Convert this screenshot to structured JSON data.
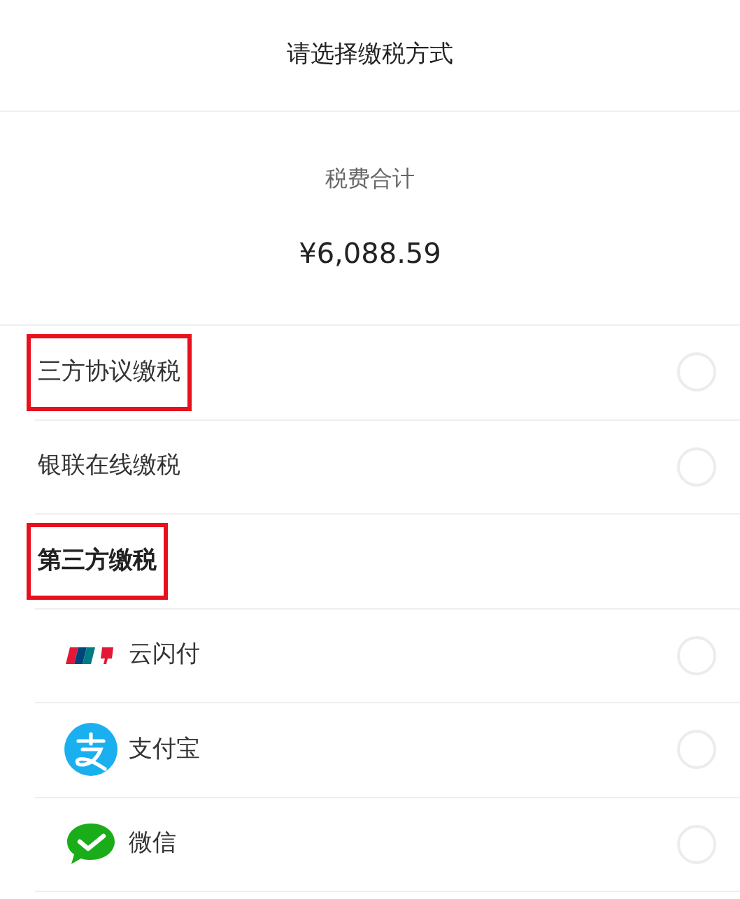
{
  "header": {
    "title": "请选择缴税方式"
  },
  "summary": {
    "label": "税费合计",
    "amount": "¥6,088.59"
  },
  "options": [
    {
      "kind": "option",
      "label": "三方协议缴税",
      "selected": false,
      "highlighted": true
    },
    {
      "kind": "option",
      "label": "银联在线缴税",
      "selected": false,
      "highlighted": false
    },
    {
      "kind": "section",
      "label": "第三方缴税",
      "highlighted": true
    },
    {
      "kind": "sub",
      "label": "云闪付",
      "selected": false,
      "highlighted": false
    },
    {
      "kind": "sub",
      "label": "支付宝",
      "selected": false,
      "highlighted": false
    },
    {
      "kind": "sub",
      "label": "微信",
      "selected": false,
      "highlighted": false
    }
  ]
}
